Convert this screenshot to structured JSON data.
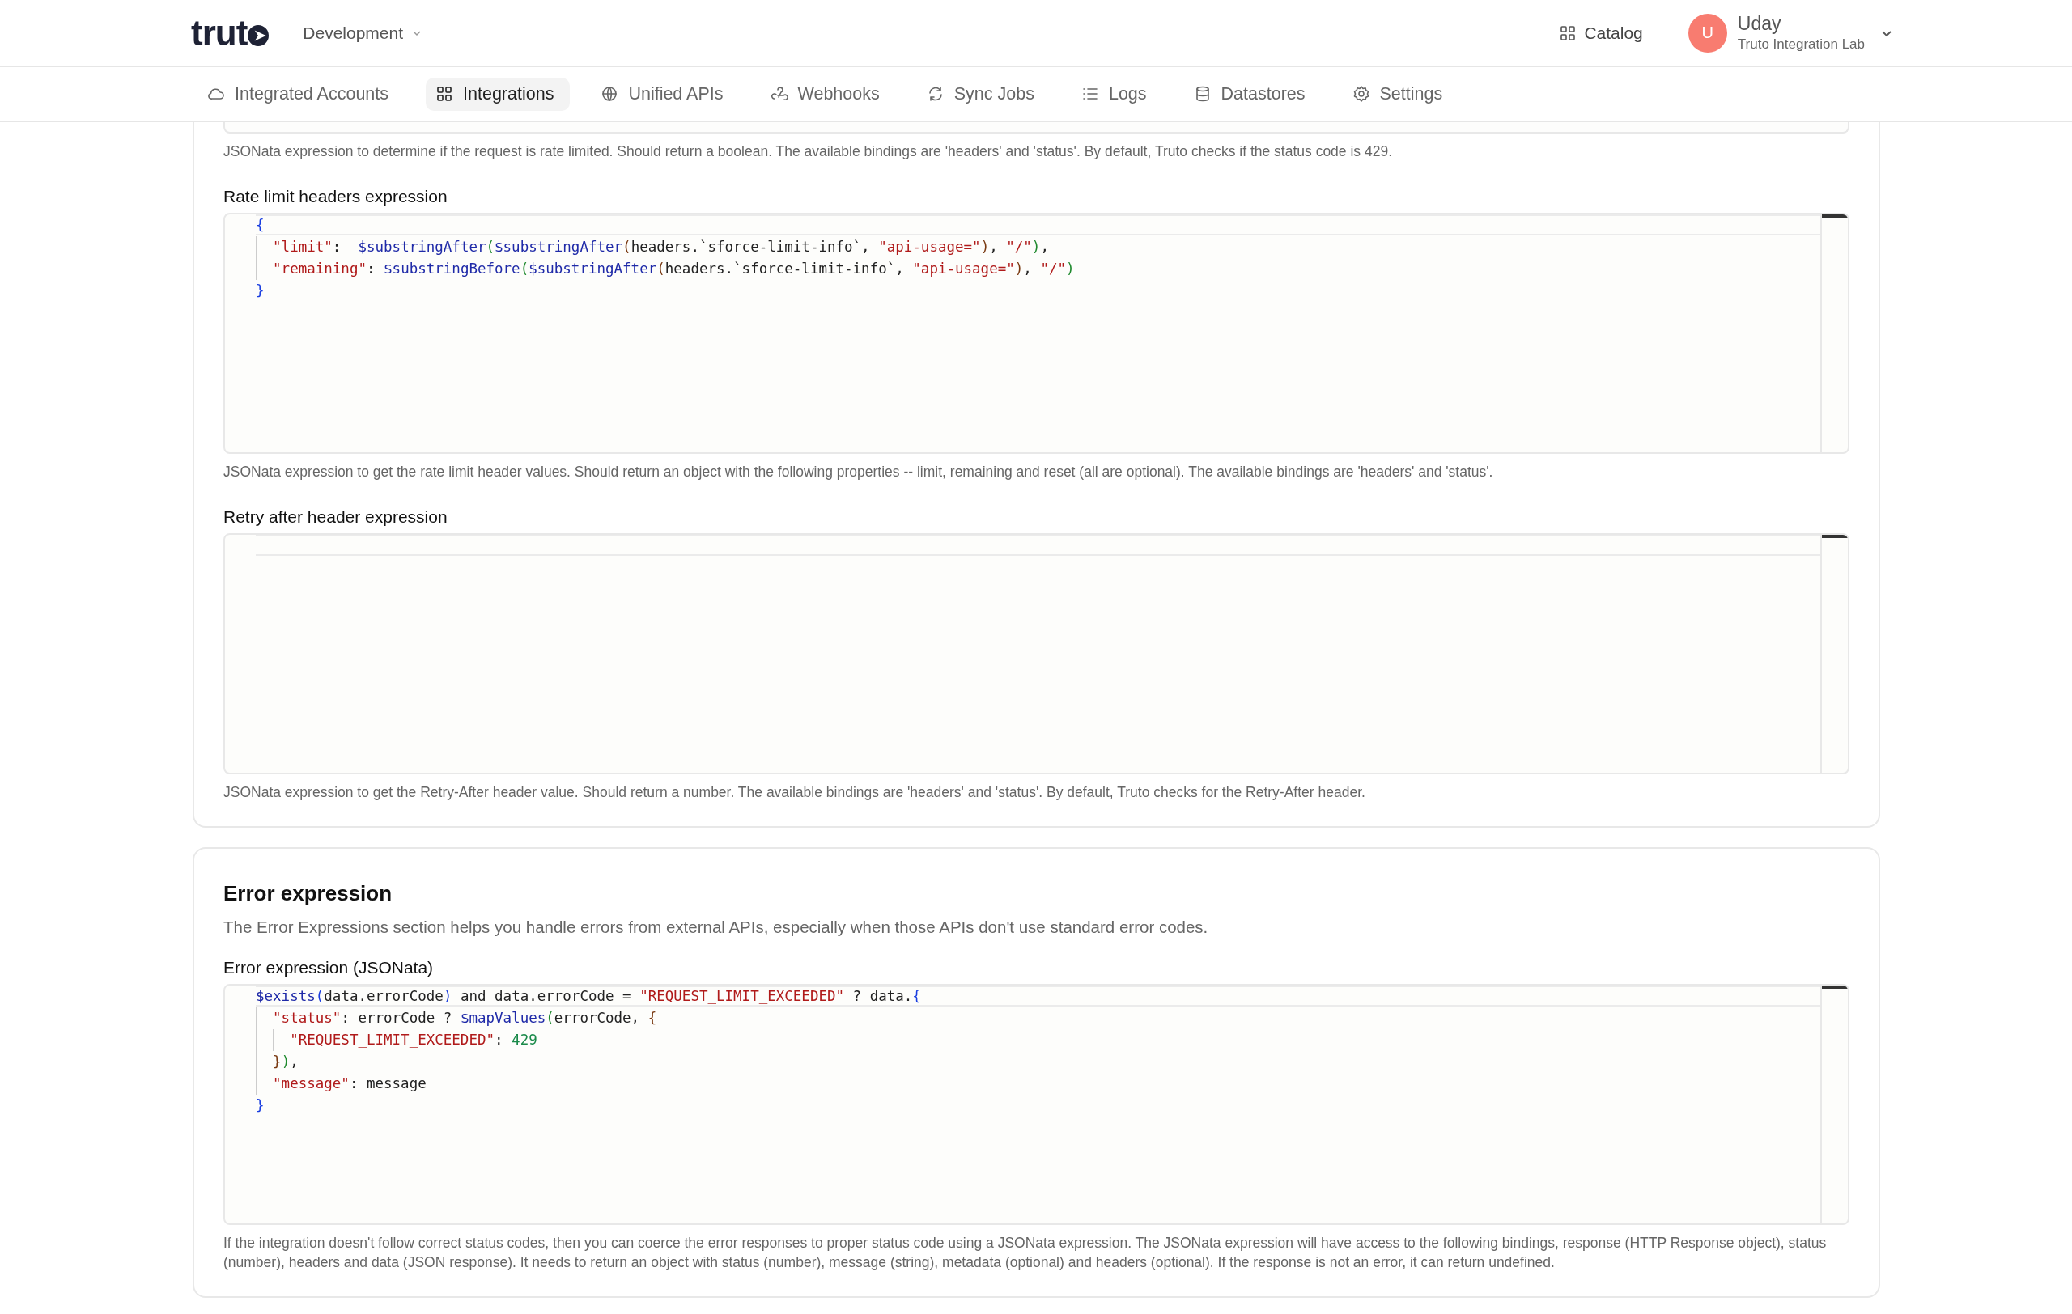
{
  "header": {
    "logo": "trut",
    "environment": "Development",
    "catalog": "Catalog",
    "user": {
      "initial": "U",
      "name": "Uday",
      "org": "Truto Integration Lab"
    }
  },
  "nav": [
    {
      "label": "Integrated Accounts",
      "selected": false
    },
    {
      "label": "Integrations",
      "selected": true
    },
    {
      "label": "Unified APIs",
      "selected": false
    },
    {
      "label": "Webhooks",
      "selected": false
    },
    {
      "label": "Sync Jobs",
      "selected": false
    },
    {
      "label": "Logs",
      "selected": false
    },
    {
      "label": "Datastores",
      "selected": false
    },
    {
      "label": "Settings",
      "selected": false
    }
  ],
  "rate_limit_card": {
    "top_field_help": "JSONata expression to determine if the request is rate limited. Should return a boolean. The available bindings are 'headers' and 'status'. By default, Truto checks if the status code is 429.",
    "fields": [
      {
        "label": "Rate limit headers expression",
        "code": [
          "{",
          "  \"limit\":  $substringAfter($substringAfter(headers.`sforce-limit-info`, \"api-usage=\"), \"/\"),",
          "  \"remaining\": $substringBefore($substringAfter(headers.`sforce-limit-info`, \"api-usage=\"), \"/\")",
          "}"
        ],
        "help": "JSONata expression to get the rate limit header values. Should return an object with the following properties -- limit, remaining and reset (all are optional). The available bindings are 'headers' and 'status'."
      },
      {
        "label": "Retry after header expression",
        "help": "JSONata expression to get the Retry-After header value. Should return a number. The available bindings are 'headers' and 'status'. By default, Truto checks for the Retry-After header."
      }
    ]
  },
  "error_card": {
    "title": "Error expression",
    "subtitle": "The Error Expressions section helps you handle errors from external APIs, especially when those APIs don't use standard error codes.",
    "fields": [
      {
        "label": "Error expression (JSONata)",
        "code": [
          "$exists(data.errorCode) and data.errorCode = \"REQUEST_LIMIT_EXCEEDED\" ? data.{",
          "  \"status\": errorCode ? $mapValues(errorCode, {",
          "    \"REQUEST_LIMIT_EXCEEDED\": 429",
          "  }),",
          "  \"message\": message",
          "}"
        ],
        "help": "If the integration doesn't follow correct status codes, then you can coerce the error responses to proper status code using a JSONata expression. The JSONata expression will have access to the following bindings, response (HTTP Response object), status (number), headers and data (JSON response). It needs to return an object with status (number), message (string), metadata (optional) and headers (optional). If the response is not an error, it can return undefined."
      }
    ]
  }
}
